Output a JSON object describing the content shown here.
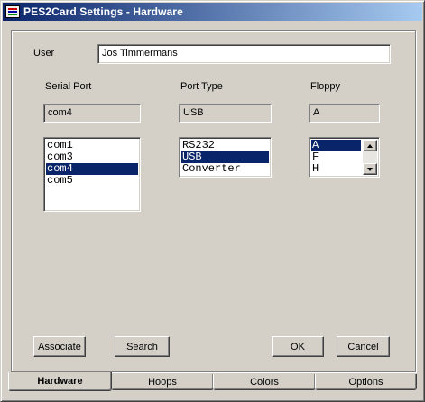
{
  "window": {
    "title": "PES2Card Settings - Hardware"
  },
  "user": {
    "label": "User",
    "value": "Jos Timmermans"
  },
  "serial_port": {
    "label": "Serial Port",
    "current": "com4",
    "options": [
      "com1",
      "com3",
      "com4",
      "com5"
    ],
    "selected": "com4"
  },
  "port_type": {
    "label": "Port Type",
    "current": "USB",
    "options": [
      "RS232",
      "USB",
      "Converter"
    ],
    "selected": "USB"
  },
  "floppy": {
    "label": "Floppy",
    "current": "A",
    "options": [
      "A",
      "F",
      "H"
    ],
    "selected": "A"
  },
  "buttons": {
    "associate": "Associate",
    "search": "Search",
    "ok": "OK",
    "cancel": "Cancel"
  },
  "tabs": [
    {
      "label": "Hardware",
      "active": true
    },
    {
      "label": "Hoops",
      "active": false
    },
    {
      "label": "Colors",
      "active": false
    },
    {
      "label": "Options",
      "active": false
    }
  ],
  "colors": {
    "title_bar": "#0a246a",
    "selection": "#0a246a",
    "face": "#d4d0c8"
  }
}
